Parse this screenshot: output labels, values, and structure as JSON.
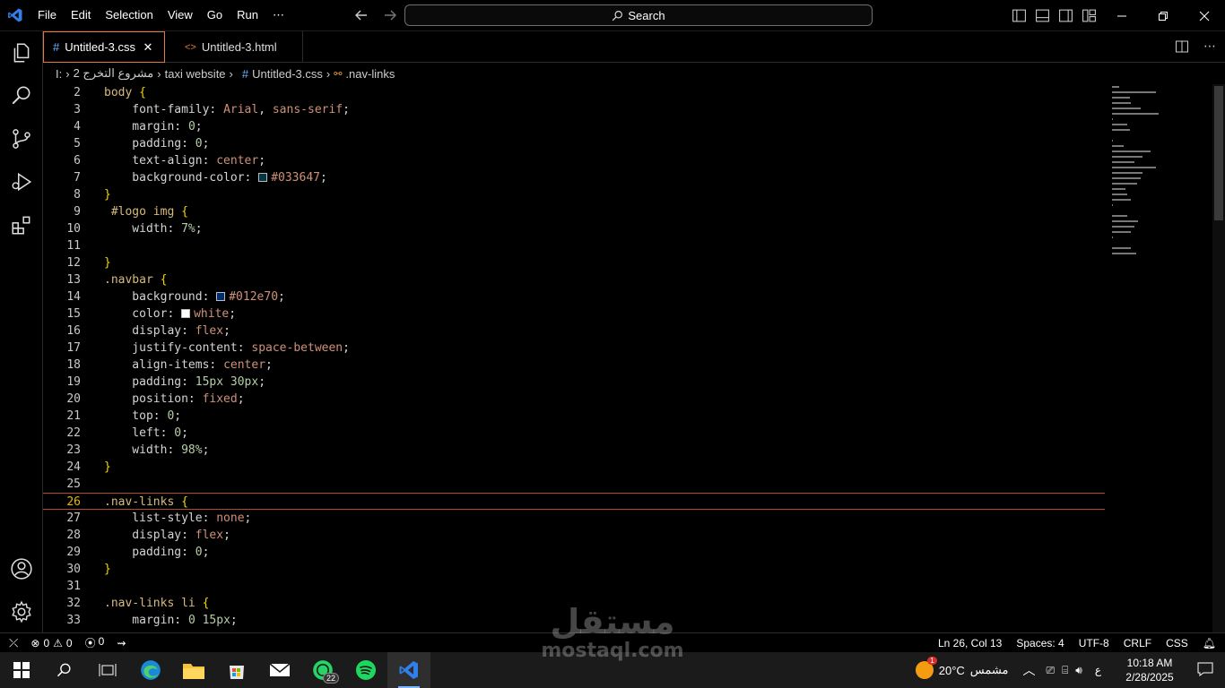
{
  "menu": {
    "items": [
      "File",
      "Edit",
      "Selection",
      "View",
      "Go",
      "Run",
      "⋯"
    ]
  },
  "search": {
    "label": "Search"
  },
  "tabs": [
    {
      "icon": "#",
      "label": "Untitled-3.css",
      "close": "✕"
    },
    {
      "icon": "<>",
      "label": "Untitled-3.html"
    }
  ],
  "breadcrumb": {
    "drive": "I:",
    "folder1": "مشروع التخرج 2",
    "folder2": "taxi website",
    "file_icon": "#",
    "file": "Untitled-3.css",
    "symbol": ".nav-links"
  },
  "editor": {
    "lines": [
      {
        "n": "2",
        "t": [
          [
            "sel",
            "body"
          ],
          [
            "punc",
            " "
          ],
          [
            "brace",
            "{"
          ]
        ]
      },
      {
        "n": "3",
        "t": [
          [
            "prop",
            "    font-family"
          ],
          [
            "punc",
            ": "
          ],
          [
            "val",
            "Arial"
          ],
          [
            "punc",
            ", "
          ],
          [
            "val",
            "sans-serif"
          ],
          [
            "punc",
            ";"
          ]
        ]
      },
      {
        "n": "4",
        "t": [
          [
            "prop",
            "    margin"
          ],
          [
            "punc",
            ": "
          ],
          [
            "num",
            "0"
          ],
          [
            "punc",
            ";"
          ]
        ]
      },
      {
        "n": "5",
        "t": [
          [
            "prop",
            "    padding"
          ],
          [
            "punc",
            ": "
          ],
          [
            "num",
            "0"
          ],
          [
            "punc",
            ";"
          ]
        ]
      },
      {
        "n": "6",
        "t": [
          [
            "prop",
            "    text-align"
          ],
          [
            "punc",
            ": "
          ],
          [
            "val",
            "center"
          ],
          [
            "punc",
            ";"
          ]
        ]
      },
      {
        "n": "7",
        "t": [
          [
            "prop",
            "    background-color"
          ],
          [
            "punc",
            ": "
          ],
          [
            "swatch",
            "#033647"
          ],
          [
            "val",
            "#033647"
          ],
          [
            "punc",
            ";"
          ]
        ]
      },
      {
        "n": "8",
        "t": [
          [
            "brace",
            "}"
          ]
        ]
      },
      {
        "n": "9",
        "t": [
          [
            "sel",
            " #logo img"
          ],
          [
            "punc",
            " "
          ],
          [
            "brace",
            "{"
          ]
        ]
      },
      {
        "n": "10",
        "t": [
          [
            "prop",
            "    width"
          ],
          [
            "punc",
            ": "
          ],
          [
            "num",
            "7%"
          ],
          [
            "punc",
            ";"
          ]
        ]
      },
      {
        "n": "11",
        "t": []
      },
      {
        "n": "12",
        "t": [
          [
            "brace",
            "}"
          ]
        ]
      },
      {
        "n": "13",
        "t": [
          [
            "sel",
            ".navbar"
          ],
          [
            "punc",
            " "
          ],
          [
            "brace",
            "{"
          ]
        ]
      },
      {
        "n": "14",
        "t": [
          [
            "prop",
            "    background"
          ],
          [
            "punc",
            ": "
          ],
          [
            "swatch",
            "#012e70"
          ],
          [
            "val",
            "#012e70"
          ],
          [
            "punc",
            ";"
          ]
        ]
      },
      {
        "n": "15",
        "t": [
          [
            "prop",
            "    color"
          ],
          [
            "punc",
            ": "
          ],
          [
            "swatch",
            "#ffffff"
          ],
          [
            "val",
            "white"
          ],
          [
            "punc",
            ";"
          ]
        ]
      },
      {
        "n": "16",
        "t": [
          [
            "prop",
            "    display"
          ],
          [
            "punc",
            ": "
          ],
          [
            "val",
            "flex"
          ],
          [
            "punc",
            ";"
          ]
        ]
      },
      {
        "n": "17",
        "t": [
          [
            "prop",
            "    justify-content"
          ],
          [
            "punc",
            ": "
          ],
          [
            "val",
            "space-between"
          ],
          [
            "punc",
            ";"
          ]
        ]
      },
      {
        "n": "18",
        "t": [
          [
            "prop",
            "    align-items"
          ],
          [
            "punc",
            ": "
          ],
          [
            "val",
            "center"
          ],
          [
            "punc",
            ";"
          ]
        ]
      },
      {
        "n": "19",
        "t": [
          [
            "prop",
            "    padding"
          ],
          [
            "punc",
            ": "
          ],
          [
            "num",
            "15px 30px"
          ],
          [
            "punc",
            ";"
          ]
        ]
      },
      {
        "n": "20",
        "t": [
          [
            "prop",
            "    position"
          ],
          [
            "punc",
            ": "
          ],
          [
            "val",
            "fixed"
          ],
          [
            "punc",
            ";"
          ]
        ]
      },
      {
        "n": "21",
        "t": [
          [
            "prop",
            "    top"
          ],
          [
            "punc",
            ": "
          ],
          [
            "num",
            "0"
          ],
          [
            "punc",
            ";"
          ]
        ]
      },
      {
        "n": "22",
        "t": [
          [
            "prop",
            "    left"
          ],
          [
            "punc",
            ": "
          ],
          [
            "num",
            "0"
          ],
          [
            "punc",
            ";"
          ]
        ]
      },
      {
        "n": "23",
        "t": [
          [
            "prop",
            "    width"
          ],
          [
            "punc",
            ": "
          ],
          [
            "num",
            "98%"
          ],
          [
            "punc",
            ";"
          ]
        ]
      },
      {
        "n": "24",
        "t": [
          [
            "brace",
            "}"
          ]
        ]
      },
      {
        "n": "25",
        "t": []
      },
      {
        "n": "26",
        "t": [
          [
            "sel",
            ".nav-links"
          ],
          [
            "punc",
            " "
          ],
          [
            "brace",
            "{"
          ]
        ],
        "current": true
      },
      {
        "n": "27",
        "t": [
          [
            "prop",
            "    list-style"
          ],
          [
            "punc",
            ": "
          ],
          [
            "val",
            "none"
          ],
          [
            "punc",
            ";"
          ]
        ]
      },
      {
        "n": "28",
        "t": [
          [
            "prop",
            "    display"
          ],
          [
            "punc",
            ": "
          ],
          [
            "val",
            "flex"
          ],
          [
            "punc",
            ";"
          ]
        ]
      },
      {
        "n": "29",
        "t": [
          [
            "prop",
            "    padding"
          ],
          [
            "punc",
            ": "
          ],
          [
            "num",
            "0"
          ],
          [
            "punc",
            ";"
          ]
        ]
      },
      {
        "n": "30",
        "t": [
          [
            "brace",
            "}"
          ]
        ]
      },
      {
        "n": "31",
        "t": []
      },
      {
        "n": "32",
        "t": [
          [
            "sel",
            ".nav-links li"
          ],
          [
            "punc",
            " "
          ],
          [
            "brace",
            "{"
          ]
        ]
      },
      {
        "n": "33",
        "t": [
          [
            "prop",
            "    margin"
          ],
          [
            "punc",
            ": "
          ],
          [
            "num",
            "0 15px"
          ],
          [
            "punc",
            ";"
          ]
        ]
      }
    ]
  },
  "status": {
    "errors": "0",
    "warnings": "0",
    "ports": "0",
    "position": "Ln 26, Col 13",
    "spaces": "Spaces: 4",
    "encoding": "UTF-8",
    "eol": "CRLF",
    "language": "CSS"
  },
  "taskbar": {
    "whatsapp_badge": "22",
    "weather_badge": "1",
    "temperature": "20°C",
    "weather_text": "مشمس",
    "lang": "ع",
    "time": "10:18 AM",
    "date": "2/28/2025"
  },
  "watermark": {
    "arabic": "مستقل",
    "latin": "mostaql.com"
  },
  "colors": {
    "accent": "#e07a3f",
    "vscode_blue": "#2f80ed"
  }
}
